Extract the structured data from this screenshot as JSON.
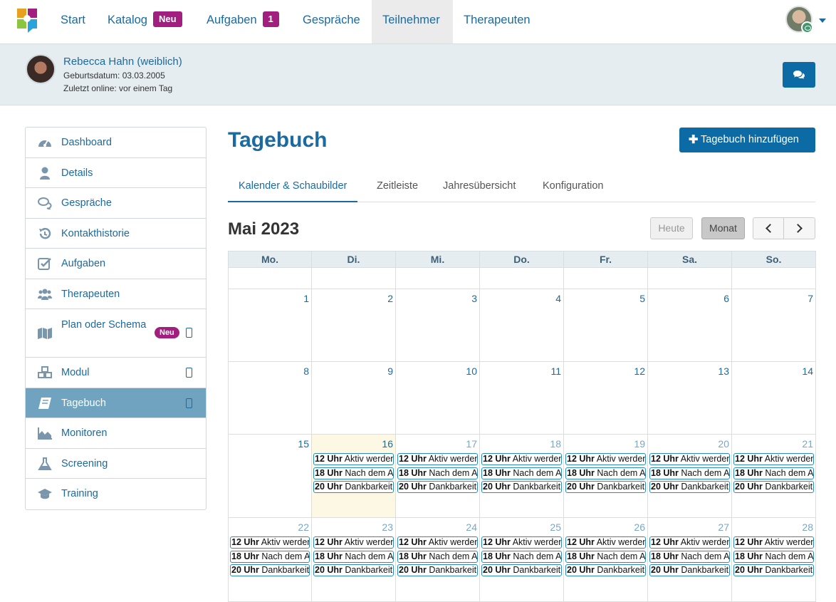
{
  "nav": {
    "start": "Start",
    "katalog": "Katalog",
    "katalog_badge": "Neu",
    "aufgaben": "Aufgaben",
    "aufgaben_badge": "1",
    "gespraeche": "Gespräche",
    "teilnehmer": "Teilnehmer",
    "therapeuten": "Therapeuten"
  },
  "patient": {
    "name": "Rebecca Hahn (weiblich)",
    "dob": "Geburtsdatum: 03.03.2005",
    "last_online": "Zuletzt online: vor einem Tag"
  },
  "sidebar": {
    "items": [
      {
        "label": "Dashboard",
        "icon": "dashboard-icon"
      },
      {
        "label": "Details",
        "icon": "user-icon"
      },
      {
        "label": "Gespräche",
        "icon": "chat-icon"
      },
      {
        "label": "Kontakthistorie",
        "icon": "history-icon"
      },
      {
        "label": "Aufgaben",
        "icon": "checkbox-icon"
      },
      {
        "label": "Therapeuten",
        "icon": "users-icon"
      },
      {
        "label": "Plan oder Schema",
        "icon": "map-icon",
        "badge": "Neu",
        "mobile": true
      },
      {
        "label": "Modul",
        "icon": "cubes-icon",
        "mobile": true
      },
      {
        "label": "Tagebuch",
        "icon": "book-icon",
        "mobile": true,
        "active": true
      },
      {
        "label": "Monitoren",
        "icon": "area-chart-icon"
      },
      {
        "label": "Screening",
        "icon": "flask-icon"
      },
      {
        "label": "Training",
        "icon": "graduation-cap-icon"
      }
    ]
  },
  "main": {
    "title": "Tagebuch",
    "add_button": "Tagebuch hinzufügen",
    "tabs": [
      "Kalender & Schaubilder",
      "Zeitleiste",
      "Jahresübersicht",
      "Konfiguration"
    ],
    "active_tab": 0
  },
  "calendar": {
    "month_title": "Mai 2023",
    "today_label": "Heute",
    "month_label": "Monat",
    "weekdays": [
      "Mo.",
      "Di.",
      "Mi.",
      "Do.",
      "Fr.",
      "Sa.",
      "So."
    ],
    "today_day": 16,
    "weeks": [
      {
        "days": [
          null,
          null,
          null,
          null,
          null,
          null,
          null
        ]
      },
      {
        "days": [
          1,
          2,
          3,
          4,
          5,
          6,
          7
        ]
      },
      {
        "days": [
          8,
          9,
          10,
          11,
          12,
          13,
          14
        ]
      },
      {
        "days": [
          15,
          16,
          17,
          18,
          19,
          20,
          21
        ]
      },
      {
        "days": [
          22,
          23,
          24,
          25,
          26,
          27,
          28
        ]
      }
    ],
    "events": [
      {
        "time": "12 Uhr",
        "text": "Aktiv werden"
      },
      {
        "time": "18 Uhr",
        "text": "Nach dem Abendessen"
      },
      {
        "time": "20 Uhr",
        "text": "Dankbarkeit"
      }
    ],
    "event_days": [
      16,
      17,
      18,
      19,
      20,
      21,
      22,
      23,
      24,
      25,
      26,
      27,
      28
    ]
  }
}
